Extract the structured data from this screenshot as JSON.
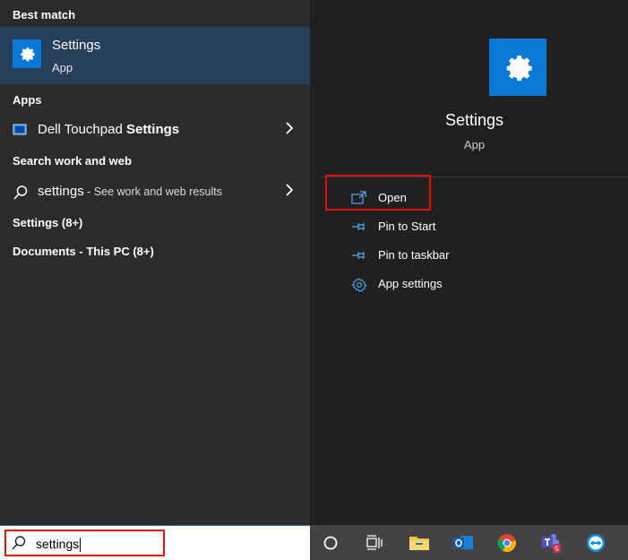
{
  "left": {
    "best_match_header": "Best match",
    "best_match": {
      "title": "Settings",
      "subtitle": "App"
    },
    "apps_header": "Apps",
    "apps": [
      {
        "label_prefix": "Dell Touchpad ",
        "label_bold": "Settings"
      }
    ],
    "search_web_header": "Search work and web",
    "web_result": {
      "query": "settings",
      "suffix": " - See work and web results"
    },
    "settings_group": "Settings (8+)",
    "documents_group": "Documents - This PC (8+)"
  },
  "right": {
    "app_title": "Settings",
    "app_subtitle": "App",
    "actions": [
      {
        "label": "Open",
        "icon": "open-window-icon"
      },
      {
        "label": "Pin to Start",
        "icon": "pin-icon"
      },
      {
        "label": "Pin to taskbar",
        "icon": "pin-icon"
      },
      {
        "label": "App settings",
        "icon": "gear-icon"
      }
    ]
  },
  "search": {
    "value": "settings"
  },
  "taskbar": {
    "items": [
      "cortana-circle-icon",
      "task-view-icon",
      "file-explorer-icon",
      "outlook-icon",
      "chrome-icon",
      "teams-icon",
      "teamviewer-icon"
    ],
    "teams_badge": "5"
  },
  "colors": {
    "accent": "#0a78d7",
    "highlight_box": "#e01010",
    "selected_row": "#263f5a"
  }
}
